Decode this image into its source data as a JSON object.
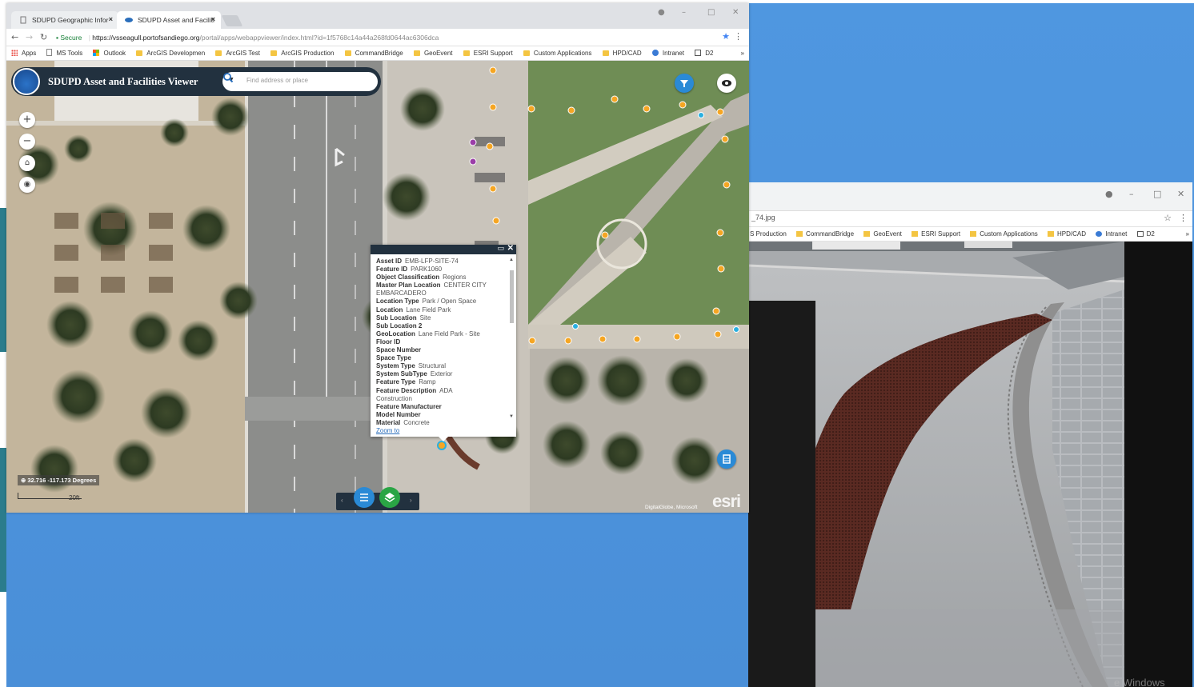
{
  "browser": {
    "tabs": [
      {
        "label": "SDUPD Geographic Infor",
        "active": false
      },
      {
        "label": "SDUPD Asset and Faciliti",
        "active": true
      }
    ],
    "tab_close": "×",
    "url_secure_label": "Secure",
    "url_host": "https://vsseagull.portofsandiego.org",
    "url_path": "/portal/apps/webappviewer/index.html?id=1f5768c14a44a268fd0644ac6306dca",
    "bookmarks": [
      {
        "label": "Apps",
        "icon": "apps-grid-icon"
      },
      {
        "label": "MS Tools",
        "icon": "page-icon"
      },
      {
        "label": "Outlook",
        "icon": "microsoft-icon"
      },
      {
        "label": "ArcGIS Developmen",
        "icon": "folder-icon"
      },
      {
        "label": "ArcGIS Test",
        "icon": "folder-icon"
      },
      {
        "label": "ArcGIS Production",
        "icon": "folder-icon"
      },
      {
        "label": "CommandBridge",
        "icon": "folder-icon"
      },
      {
        "label": "GeoEvent",
        "icon": "folder-icon"
      },
      {
        "label": "ESRI Support",
        "icon": "folder-icon"
      },
      {
        "label": "Custom Applications",
        "icon": "folder-icon"
      },
      {
        "label": "HPD/CAD",
        "icon": "folder-icon"
      },
      {
        "label": "Intranet",
        "icon": "globe-icon"
      },
      {
        "label": "D2",
        "icon": "image-icon"
      }
    ],
    "bookmarks_more": "»"
  },
  "app": {
    "title": "SDUPD Asset and Facilities Viewer",
    "search_placeholder": "Find address or place",
    "coordinates": "32.716 -117.173 Degrees",
    "scale_label": "20ft",
    "attribution": "DigitalGlobe, Microsoft",
    "esri_logo": "esri"
  },
  "popup": {
    "fields": [
      {
        "key": "Asset ID",
        "value": "EMB-LFP-SITE-74"
      },
      {
        "key": "Feature ID",
        "value": "PARK1060"
      },
      {
        "key": "Object Classification",
        "value": "Regions"
      },
      {
        "key": "Master Plan Location",
        "value": "CENTER CITY"
      },
      {
        "key": "",
        "value": "EMBARCADERO"
      },
      {
        "key": "Location Type",
        "value": "Park / Open Space"
      },
      {
        "key": "Location",
        "value": "Lane Field Park"
      },
      {
        "key": "Sub Location",
        "value": "Site"
      },
      {
        "key": "Sub Location 2",
        "value": ""
      },
      {
        "key": "GeoLocation",
        "value": "Lane Field Park - Site"
      },
      {
        "key": "Floor ID",
        "value": ""
      },
      {
        "key": "Space Number",
        "value": ""
      },
      {
        "key": "Space Type",
        "value": ""
      },
      {
        "key": "System Type",
        "value": "Structural"
      },
      {
        "key": "System SubType",
        "value": "Exterior"
      },
      {
        "key": "Feature Type",
        "value": "Ramp"
      },
      {
        "key": "Feature Description",
        "value": "ADA"
      },
      {
        "key": "",
        "value": "Construction"
      },
      {
        "key": "Feature Manufacturer",
        "value": ""
      },
      {
        "key": "Model Number",
        "value": ""
      },
      {
        "key": "Material",
        "value": "Concrete"
      }
    ],
    "zoom_link": "Zoom to"
  },
  "photo_window": {
    "address_text": "_74.jpg",
    "bookmarks": [
      "S Production",
      "CommandBridge",
      "GeoEvent",
      "ESRI Support",
      "Custom Applications",
      "HPD/CAD",
      "Intranet",
      "D2"
    ],
    "bookmarks_more": "»"
  },
  "desktop": {
    "watermark": "e Windows"
  },
  "colors": {
    "header": "#22313f",
    "accent": "#2a8ad6",
    "marker": "#f5a623",
    "desktop_blue": "#4a8fd8"
  }
}
